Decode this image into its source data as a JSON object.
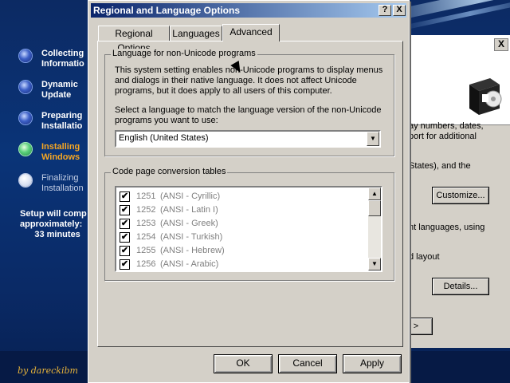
{
  "setup": {
    "steps": [
      {
        "label": "Collecting\nInformatio",
        "state": "done"
      },
      {
        "label": "Dynamic\nUpdate",
        "state": "done"
      },
      {
        "label": "Preparing\nInstallatio",
        "state": "done"
      },
      {
        "label": "Installing\nWindows",
        "state": "active"
      },
      {
        "label": "Finalizing\nInstallation",
        "state": "future"
      }
    ],
    "time_text": "Setup will comp\napproximately:\n      33 minutes",
    "credit": "by dareckibm"
  },
  "background_dialog": {
    "text1": "ay numbers, dates,\nport for additional",
    "text2": "States), and the",
    "customize_label": "Customize...",
    "text3": "nt languages, using",
    "text4": "d layout",
    "details_label": "Details...",
    "arrow_label": ">"
  },
  "dialog": {
    "title": "Regional and Language Options",
    "help_btn": "?",
    "close_btn": "X",
    "tabs": [
      "Regional Options",
      "Languages",
      "Advanced"
    ],
    "selected_tab": "Advanced",
    "nonunicode": {
      "legend": "Language for non-Unicode programs",
      "desc": "This system setting enables non-Unicode programs to display menus\nand dialogs in their native language. It does not affect Unicode\nprograms, but it does apply to all users of this computer.",
      "select_prompt": "Select a language to match the language version of the non-Unicode\nprograms you want to use:",
      "selected_language": "English (United States)"
    },
    "codepage": {
      "legend": "Code page conversion tables",
      "rows": [
        {
          "code": "1251",
          "name": "(ANSI - Cyrillic)",
          "checked": true
        },
        {
          "code": "1252",
          "name": "(ANSI - Latin I)",
          "checked": true
        },
        {
          "code": "1253",
          "name": "(ANSI - Greek)",
          "checked": true
        },
        {
          "code": "1254",
          "name": "(ANSI - Turkish)",
          "checked": true
        },
        {
          "code": "1255",
          "name": "(ANSI - Hebrew)",
          "checked": true
        },
        {
          "code": "1256",
          "name": "(ANSI - Arabic)",
          "checked": true
        }
      ]
    },
    "buttons": {
      "ok": "OK",
      "cancel": "Cancel",
      "apply": "Apply"
    }
  },
  "icons": {
    "checkmark": "✔",
    "arrow_down": "▼",
    "arrow_up": "▲"
  }
}
